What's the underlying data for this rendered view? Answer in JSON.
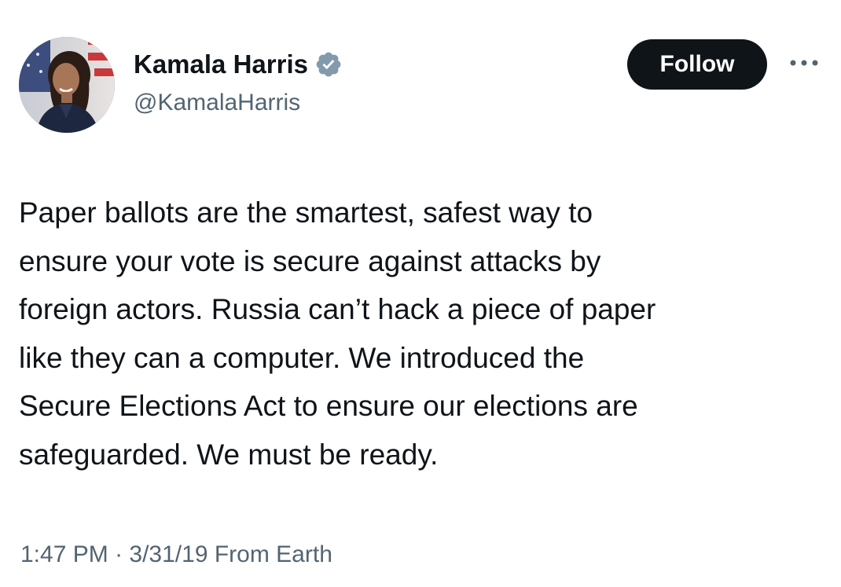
{
  "tweet": {
    "author": {
      "display_name": "Kamala Harris",
      "handle": "@KamalaHarris",
      "verified_icon": "verified-badge-icon",
      "avatar_icon": "avatar"
    },
    "follow_label": "Follow",
    "more_icon": "more-icon",
    "text": "Paper ballots are the smartest, safest way to\nensure your vote is secure against attacks by\nforeign actors. Russia can’t hack a piece of paper\nlike they can a computer. We introduced the\nSecure Elections Act to ensure our elections are\nsafeguarded. We must be ready.",
    "time": "1:47 PM",
    "separator": " · ",
    "date": "3/31/19",
    "source": "From Earth"
  },
  "colors": {
    "text_primary": "#0f1419",
    "text_secondary": "#536471",
    "follow_bg": "#0f1419",
    "follow_text": "#ffffff",
    "verified_badge": "#829aab"
  }
}
